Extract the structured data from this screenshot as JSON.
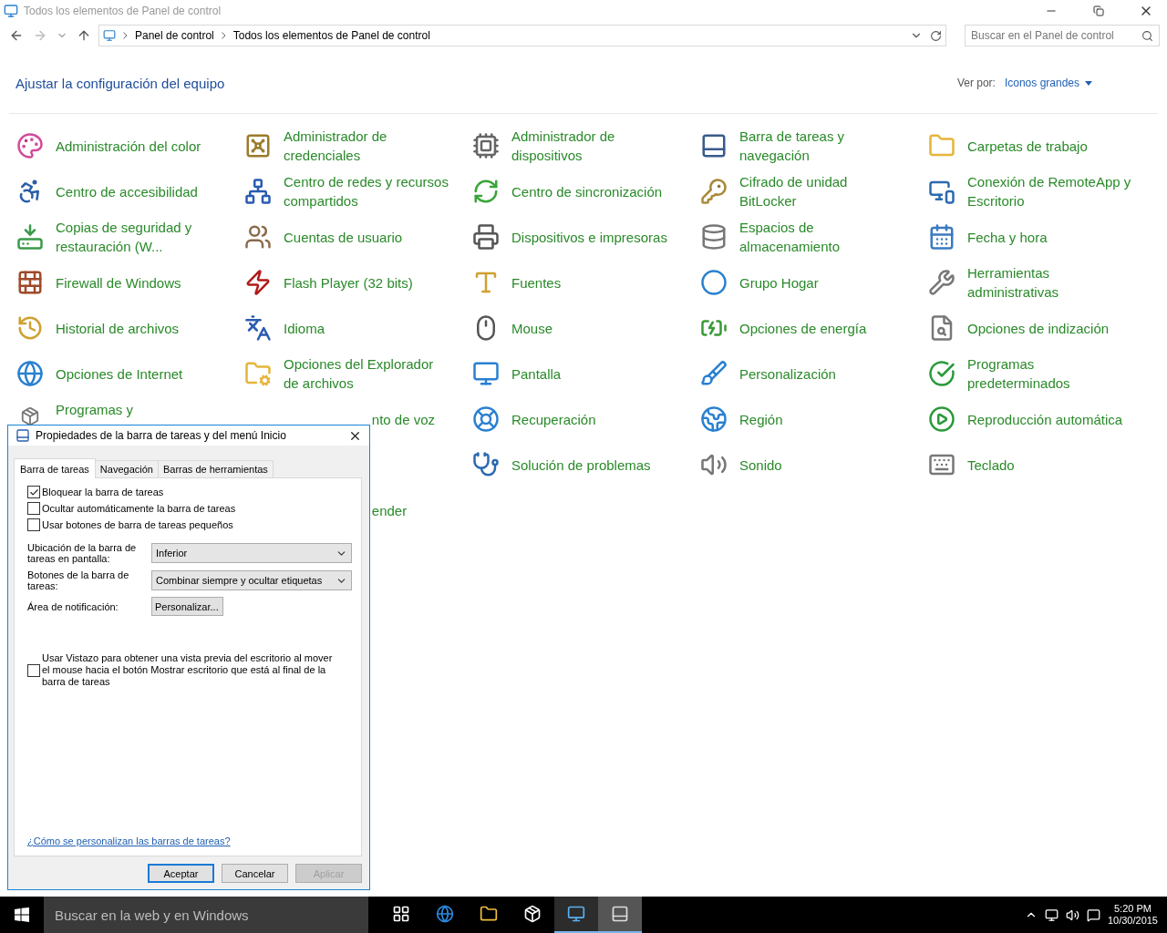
{
  "window": {
    "title": "Todos los elementos de Panel de control"
  },
  "address_bar": {
    "path": [
      "Panel de control",
      "Todos los elementos de Panel de control"
    ]
  },
  "search": {
    "placeholder": "Buscar en el Panel de control"
  },
  "header": {
    "title": "Ajustar la configuración del equipo",
    "view_label": "Ver por:",
    "view_value": "Iconos grandes"
  },
  "grid": [
    [
      {
        "kind": "item",
        "label": "Administración del color"
      },
      {
        "kind": "item",
        "label": "Administrador de credenciales"
      },
      {
        "kind": "item",
        "label": "Administrador de dispositivos"
      },
      {
        "kind": "item",
        "label": "Barra de tareas y navegación"
      },
      {
        "kind": "item",
        "label": "Carpetas de trabajo"
      }
    ],
    [
      {
        "kind": "item",
        "label": "Centro de accesibilidad"
      },
      {
        "kind": "item",
        "label": "Centro de redes y recursos compartidos"
      },
      {
        "kind": "item",
        "label": "Centro de sincronización"
      },
      {
        "kind": "item",
        "label": "Cifrado de unidad BitLocker"
      },
      {
        "kind": "item",
        "label": "Conexión de RemoteApp y Escritorio"
      }
    ],
    [
      {
        "kind": "item",
        "label": "Copias de seguridad y restauración (W..."
      },
      {
        "kind": "item",
        "label": "Cuentas de usuario"
      },
      {
        "kind": "item",
        "label": "Dispositivos e impresoras"
      },
      {
        "kind": "item",
        "label": "Espacios de almacenamiento"
      },
      {
        "kind": "item",
        "label": "Fecha y hora"
      }
    ],
    [
      {
        "kind": "item",
        "label": "Firewall de Windows"
      },
      {
        "kind": "item",
        "label": "Flash Player (32 bits)"
      },
      {
        "kind": "item",
        "label": "Fuentes"
      },
      {
        "kind": "item",
        "label": "Grupo Hogar"
      },
      {
        "kind": "item",
        "label": "Herramientas administrativas"
      }
    ],
    [
      {
        "kind": "item",
        "label": "Historial de archivos"
      },
      {
        "kind": "item",
        "label": "Idioma"
      },
      {
        "kind": "item",
        "label": "Mouse"
      },
      {
        "kind": "item",
        "label": "Opciones de energía"
      },
      {
        "kind": "item",
        "label": "Opciones de indización"
      }
    ],
    [
      {
        "kind": "item",
        "label": "Opciones de Internet"
      },
      {
        "kind": "item",
        "label": "Opciones del Explorador de archivos"
      },
      {
        "kind": "item",
        "label": "Pantalla"
      },
      {
        "kind": "item",
        "label": "Personalización"
      },
      {
        "kind": "item",
        "label": "Programas predeterminados"
      }
    ],
    [
      {
        "kind": "peek",
        "label": "Programas y"
      },
      {
        "kind": "covered",
        "label": "nto de voz"
      },
      {
        "kind": "item",
        "label": "Recuperación"
      },
      {
        "kind": "item",
        "label": "Región"
      },
      {
        "kind": "item",
        "label": "Reproducción automática"
      }
    ],
    [
      {
        "kind": "hidden"
      },
      {
        "kind": "hidden"
      },
      {
        "kind": "item",
        "label": "Solución de problemas"
      },
      {
        "kind": "item",
        "label": "Sonido"
      },
      {
        "kind": "item",
        "label": "Teclado"
      }
    ],
    [
      {
        "kind": "hidden"
      },
      {
        "kind": "covered",
        "label": "ender"
      }
    ]
  ],
  "dialog": {
    "title": "Propiedades de la barra de tareas y del menú Inicio",
    "tabs": [
      {
        "label": "Barra de tareas",
        "selected": true
      },
      {
        "label": "Navegación",
        "selected": false
      },
      {
        "label": "Barras de herramientas",
        "selected": false
      }
    ],
    "checkboxes": [
      {
        "label": "Bloquear la barra de tareas",
        "checked": true
      },
      {
        "label": "Ocultar automáticamente la barra de tareas",
        "checked": false
      },
      {
        "label": "Usar botones de barra de tareas pequeños",
        "checked": false
      }
    ],
    "fields": [
      {
        "kind": "select",
        "label": "Ubicación de la barra de tareas en pantalla:",
        "value": "Inferior"
      },
      {
        "kind": "select",
        "label": "Botones de la barra de tareas:",
        "value": "Combinar siempre y ocultar etiquetas"
      },
      {
        "kind": "button",
        "label": "Área de notificación:",
        "value": "Personalizar..."
      }
    ],
    "peek": {
      "label": "Usar Vistazo para obtener una vista previa del escritorio al mover el mouse hacia el botón Mostrar escritorio que está al final de la barra de tareas",
      "checked": false
    },
    "help_link": "¿Cómo se personalizan las barras de tareas?",
    "buttons": [
      {
        "label": "Aceptar",
        "default": true,
        "disabled": false
      },
      {
        "label": "Cancelar",
        "default": false,
        "disabled": false
      },
      {
        "label": "Aplicar",
        "default": false,
        "disabled": true
      }
    ]
  },
  "taskbar": {
    "search_placeholder": "Buscar en la web y en Windows",
    "apps": [
      {
        "running": false,
        "selected": false
      },
      {
        "running": false,
        "selected": false
      },
      {
        "running": false,
        "selected": false
      },
      {
        "running": false,
        "selected": false
      },
      {
        "running": true,
        "selected": false
      },
      {
        "running": true,
        "selected": true
      }
    ],
    "time": "5:20 PM",
    "date": "10/30/2015"
  }
}
